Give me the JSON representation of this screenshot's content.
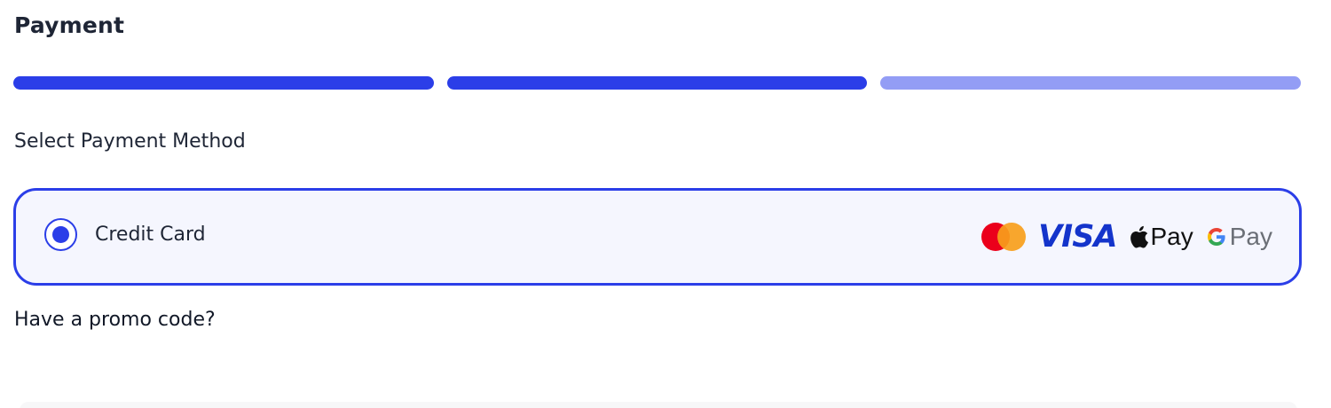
{
  "page": {
    "title": "Payment"
  },
  "progress": {
    "steps": [
      {
        "state": "complete",
        "color": "#2b3ee8"
      },
      {
        "state": "complete",
        "color": "#2b3ee8"
      },
      {
        "state": "current",
        "color": "#939df5"
      }
    ],
    "completed_fraction": 0.67
  },
  "payment_method": {
    "section_label": "Select Payment Method",
    "options": [
      {
        "label": "Credit Card",
        "selected": true,
        "brand_logos": [
          "mastercard-logo",
          "visa-logo",
          "apple-pay-logo",
          "google-pay-logo"
        ]
      }
    ]
  },
  "brands": {
    "visa_text": "VISA",
    "apple_pay_text": "Pay",
    "google_pay_text": "Pay",
    "mastercard_colors": [
      "#eb001b",
      "#f79e1b"
    ],
    "visa_color": "#1434cb"
  },
  "promo": {
    "prompt": "Have a promo code?"
  },
  "colors": {
    "accent": "#2b3ee8",
    "accent_light": "#939df5",
    "card_background": "#f5f6fe",
    "text": "#1e2535"
  }
}
